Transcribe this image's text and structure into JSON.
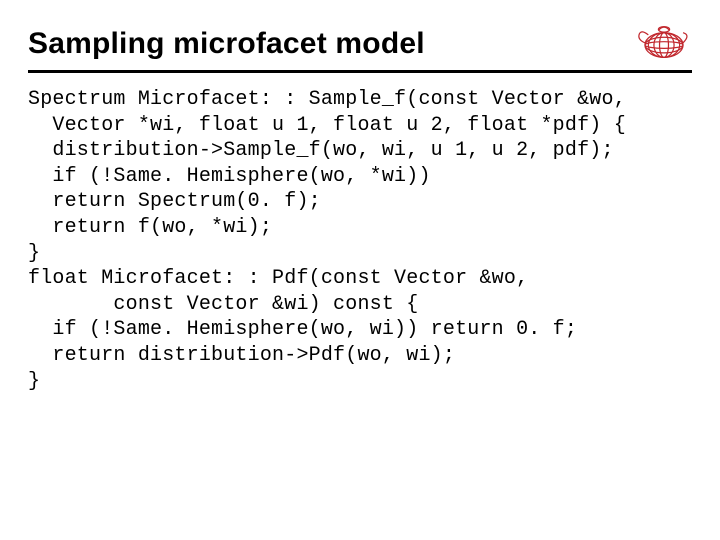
{
  "slide": {
    "title": "Sampling microfacet model",
    "logo_alt": "red wireframe teapot",
    "code_lines": [
      "Spectrum Microfacet: : Sample_f(const Vector &wo,",
      "  Vector *wi, float u 1, float u 2, float *pdf) {",
      "  distribution->Sample_f(wo, wi, u 1, u 2, pdf);",
      "  if (!Same. Hemisphere(wo, *wi))",
      "  return Spectrum(0. f);",
      "  return f(wo, *wi);",
      "}",
      "float Microfacet: : Pdf(const Vector &wo,",
      "       const Vector &wi) const {",
      "  if (!Same. Hemisphere(wo, wi)) return 0. f;",
      "  return distribution->Pdf(wo, wi);",
      "}"
    ]
  }
}
